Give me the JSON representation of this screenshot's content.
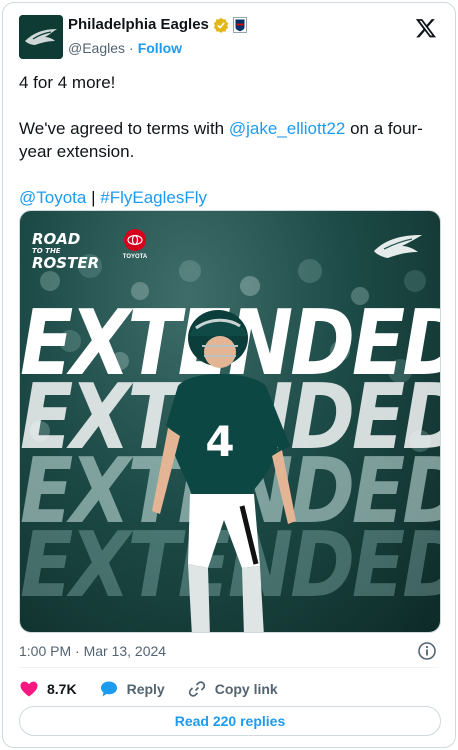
{
  "author": {
    "name": "Philadelphia Eagles",
    "handle": "@Eagles",
    "separator": "·",
    "follow_label": "Follow"
  },
  "tweet": {
    "line1": "4 for 4 more!",
    "line2_prefix": "We've agreed to terms with ",
    "line2_mention": "@jake_elliott22",
    "line2_suffix": " on a four-year extension.",
    "mention_toyota": "@Toyota",
    "pipe": " | ",
    "hashtag": "#FlyEaglesFly"
  },
  "media": {
    "badge_line1": "ROAD",
    "badge_line2": "TO THE",
    "badge_line3": "ROSTER",
    "sponsor": "TOYOTA",
    "headline": "EXTENDED",
    "jersey_number": "4"
  },
  "meta": {
    "time": "1:00 PM · Mar 13, 2024"
  },
  "actions": {
    "likes": "8.7K",
    "reply_label": "Reply",
    "copy_link_label": "Copy link"
  },
  "replies_button": "Read 220 replies",
  "colors": {
    "link": "#1d9bf0",
    "like": "#f91880",
    "eagles_green": "#004c54"
  }
}
